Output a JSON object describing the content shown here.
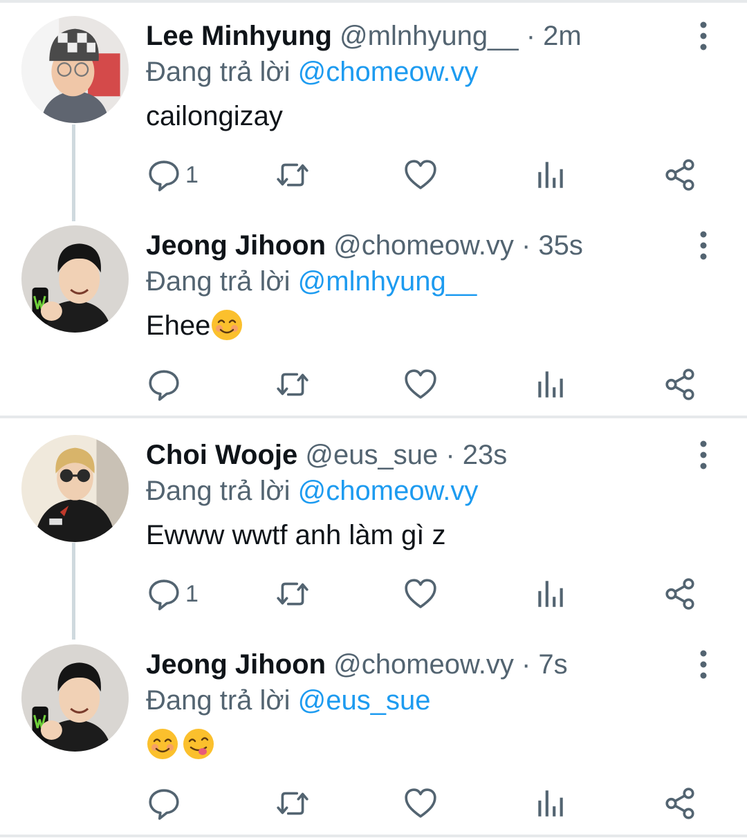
{
  "tweets": [
    {
      "name": "Lee Minhyung",
      "handle": "@mlnhyung__",
      "time": "2m",
      "reply_label": "Đang trả lời",
      "reply_to": "@chomeow.vy",
      "text": "cailongizay",
      "emojis": [],
      "reply_count": "1",
      "avatar_icon": "avatar-lee-minhyung"
    },
    {
      "name": "Jeong Jihoon",
      "handle": "@chomeow.vy",
      "time": "35s",
      "reply_label": "Đang trả lời",
      "reply_to": "@mlnhyung__",
      "text": "Ehee",
      "emojis": [
        "smiling-face-emoji"
      ],
      "reply_count": "",
      "avatar_icon": "avatar-jeong-jihoon"
    },
    {
      "name": "Choi Wooje",
      "handle": "@eus_sue",
      "time": "23s",
      "reply_label": "Đang trả lời",
      "reply_to": "@chomeow.vy",
      "text": "Ewww wwtf anh làm gì z",
      "emojis": [],
      "reply_count": "1",
      "avatar_icon": "avatar-choi-wooje"
    },
    {
      "name": "Jeong Jihoon",
      "handle": "@chomeow.vy",
      "time": "7s",
      "reply_label": "Đang trả lời",
      "reply_to": "@eus_sue",
      "text": "",
      "emojis": [
        "smiling-face-emoji",
        "yum-face-emoji"
      ],
      "reply_count": "",
      "avatar_icon": "avatar-jeong-jihoon"
    }
  ],
  "separator": "·",
  "icons": [
    "reply-icon",
    "retweet-icon",
    "like-icon",
    "analytics-icon",
    "share-icon",
    "more-icon"
  ],
  "colors": {
    "link": "#1d9bf0",
    "muted": "#536471",
    "text": "#0f1419",
    "divider": "#e6e9eb"
  }
}
